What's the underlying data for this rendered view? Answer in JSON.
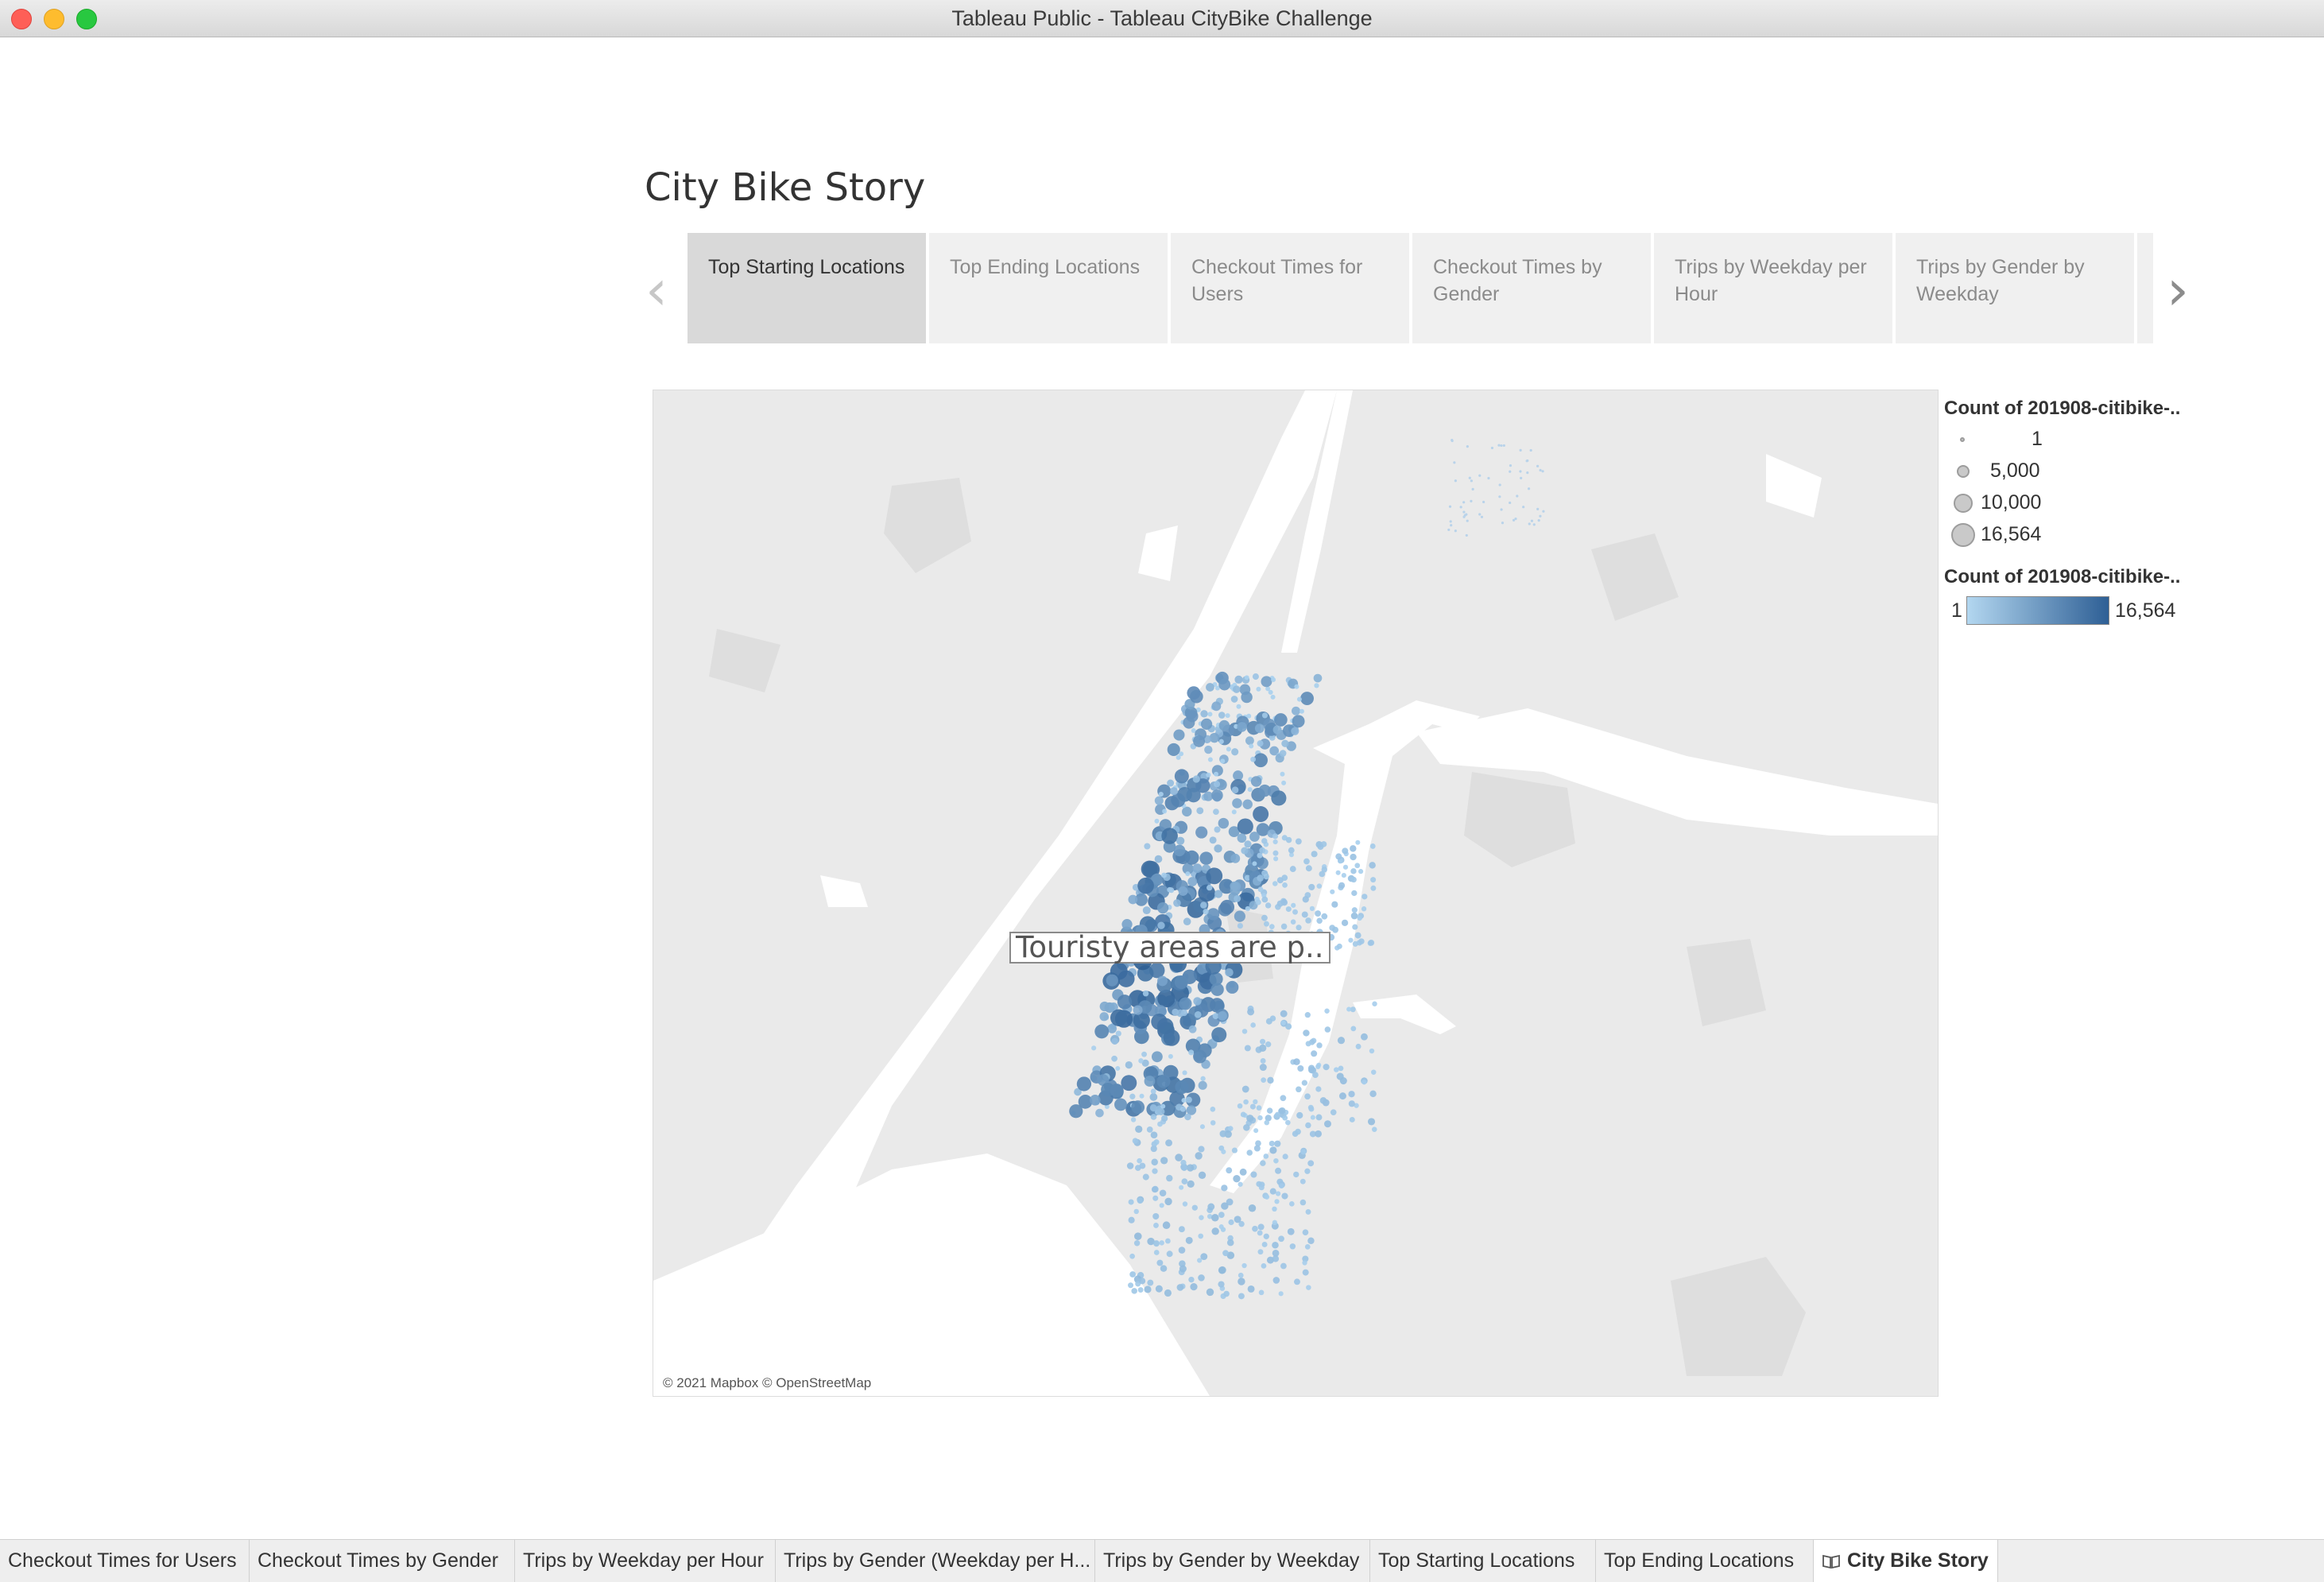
{
  "window": {
    "title": "Tableau Public - Tableau CityBike Challenge"
  },
  "story": {
    "title": "City Bike Story",
    "points": [
      {
        "label": "Top Starting Locations",
        "active": true
      },
      {
        "label": "Top Ending Locations",
        "active": false
      },
      {
        "label": "Checkout Times for Users",
        "active": false
      },
      {
        "label": "Checkout Times by Gender",
        "active": false
      },
      {
        "label": "Trips by Weekday per Hour",
        "active": false
      },
      {
        "label": "Trips by Gender by Weekday",
        "active": false
      }
    ],
    "prev_icon": "chevron-left-icon",
    "next_icon": "chevron-right-icon"
  },
  "map": {
    "credit": "© 2021 Mapbox © OpenStreetMap",
    "annotation": "Touristy areas are p..",
    "colors": {
      "land": "#eaeaea",
      "water": "#ffffff",
      "low": "#a9d0ee",
      "high": "#2b5d93"
    }
  },
  "legend": {
    "size_title": "Count of 201908-citibike-..",
    "size_items": [
      "1",
      "5,000",
      "10,000",
      "16,564"
    ],
    "color_title": "Count of 201908-citibike-..",
    "color_min": "1",
    "color_max": "16,564"
  },
  "sheet_tabs": [
    {
      "label": "Checkout Times for Users",
      "active": false
    },
    {
      "label": "Checkout Times by Gender",
      "active": false
    },
    {
      "label": "Trips by Weekday per Hour",
      "active": false
    },
    {
      "label": "Trips by Gender (Weekday per H...",
      "active": false
    },
    {
      "label": "Trips by Gender by Weekday",
      "active": false
    },
    {
      "label": "Top Starting Locations",
      "active": false
    },
    {
      "label": "Top Ending Locations",
      "active": false
    },
    {
      "label": "City Bike Story",
      "active": true,
      "icon": "book-icon"
    }
  ]
}
